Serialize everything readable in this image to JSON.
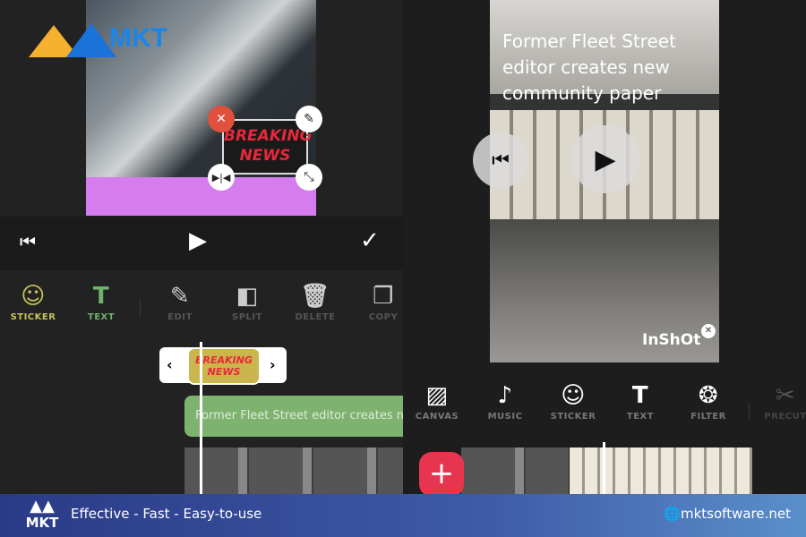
{
  "brand": {
    "logo_text": "MKT",
    "tagline": "Effective - Fast - Easy-to-use",
    "website": "mktsoftware.net"
  },
  "left": {
    "sticker_text": [
      "BREAKING",
      "NEWS"
    ],
    "toolbar": [
      {
        "label": "STICKER",
        "icon": "smile-plus-icon",
        "color": "#c9c35a"
      },
      {
        "label": "TEXT",
        "icon": "text-plus-icon",
        "color": "#6db36a"
      },
      {
        "label": "EDIT",
        "icon": "pencil-icon",
        "color": "#555"
      },
      {
        "label": "SPLIT",
        "icon": "split-icon",
        "color": "#555"
      },
      {
        "label": "DELETE",
        "icon": "trash-icon",
        "color": "#555"
      },
      {
        "label": "COPY",
        "icon": "copy-icon",
        "color": "#555"
      }
    ],
    "text_clip": "Former Fleet Street editor creates new community paper",
    "sticker_clip": "BREAKING NEWS"
  },
  "right": {
    "video_caption": "Former Fleet Street editor creates new community paper",
    "watermark": "InShOt",
    "toolbar": [
      {
        "label": "CANVAS",
        "icon": "canvas-icon"
      },
      {
        "label": "MUSIC",
        "icon": "music-icon"
      },
      {
        "label": "STICKER",
        "icon": "smile-icon"
      },
      {
        "label": "TEXT",
        "icon": "text-icon"
      },
      {
        "label": "FILTER",
        "icon": "filter-icon"
      },
      {
        "label": "PRECUT",
        "icon": "scissors-icon"
      }
    ]
  },
  "colors": {
    "accent_red": "#e8354f",
    "text_clip": "#7db36f",
    "sticker_clip": "#cbb54d",
    "purple": "#d57cef"
  }
}
